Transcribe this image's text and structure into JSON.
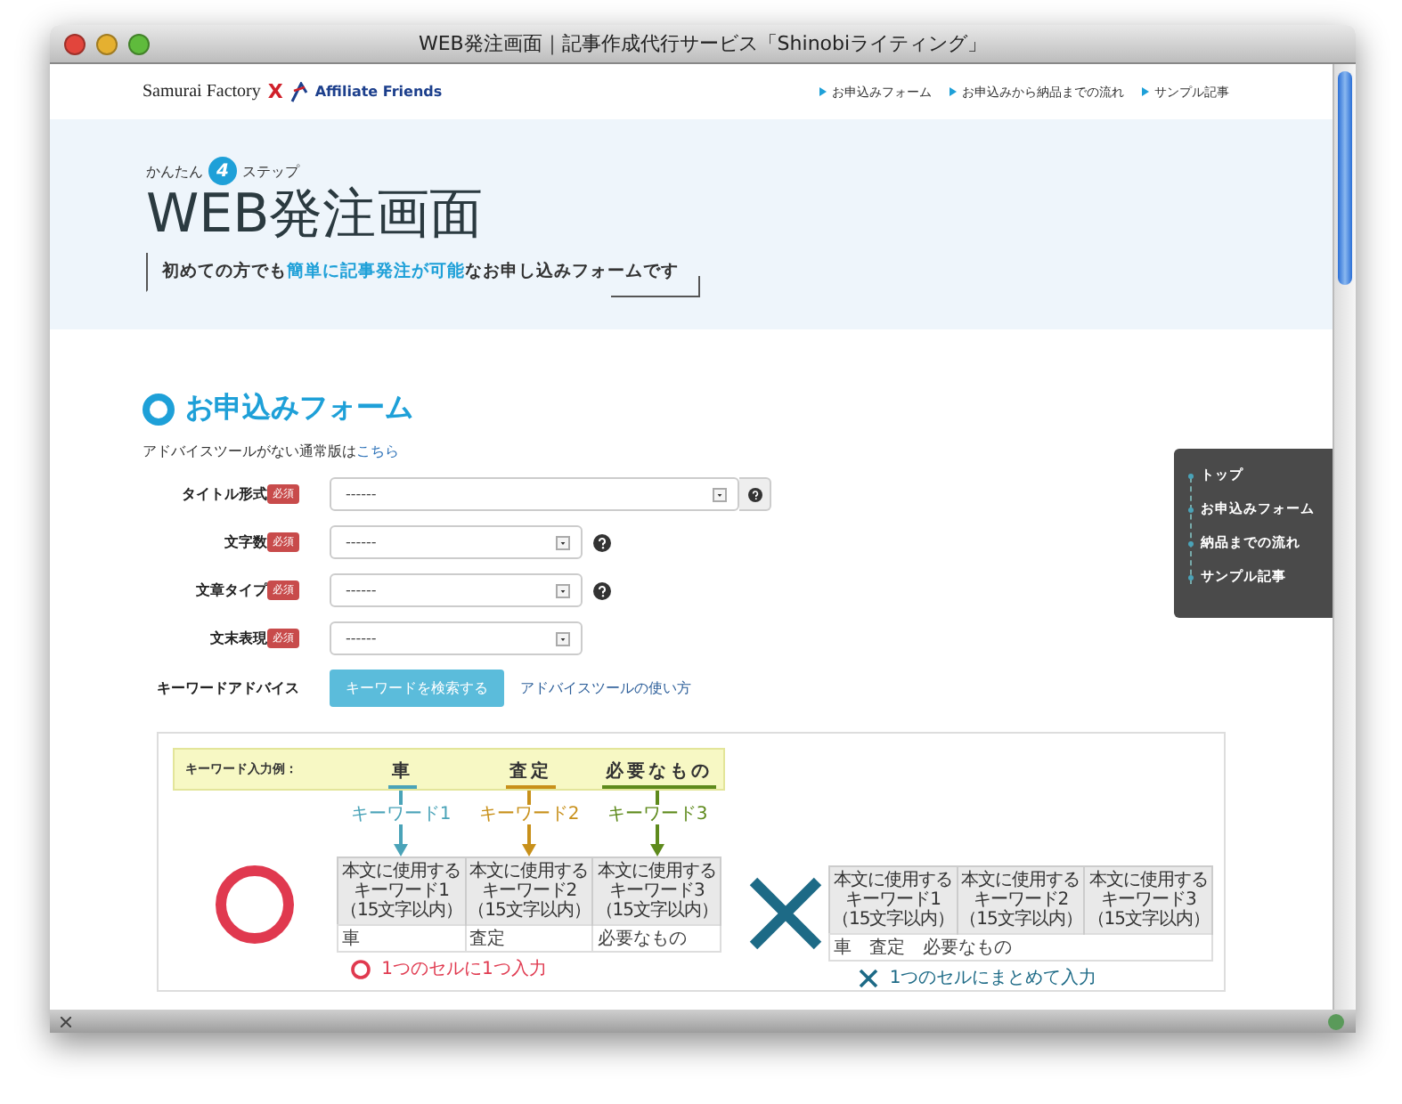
{
  "window": {
    "title": "WEB発注画面｜記事作成代行サービス「Shinobiライティング」"
  },
  "header": {
    "logo": {
      "brand1": "Samurai Factory",
      "separator": "X",
      "brand2": "Affiliate Friends"
    },
    "nav": [
      "お申込みフォーム",
      "お申込みから納品までの流れ",
      "サンプル記事"
    ]
  },
  "hero": {
    "steps_prefix": "かんたん",
    "step_number": "4",
    "steps_suffix": "ステップ",
    "title": "WEB発注画面",
    "subtitle": [
      {
        "text": "初めての方でも",
        "highlight": false
      },
      {
        "text": "簡単に記事発注が可能",
        "highlight": true
      },
      {
        "text": "なお申し込みフォームです",
        "highlight": false
      }
    ]
  },
  "section": {
    "title": "お申込みフォーム",
    "note": "アドバイスツールがない通常版は",
    "note_link": "こちら"
  },
  "form": {
    "fields": [
      {
        "label": "タイトル形式",
        "badge": "必須",
        "value": "------",
        "kind": "wide"
      },
      {
        "label": "文字数",
        "badge": "必須",
        "value": "------",
        "kind": "narrow"
      },
      {
        "label": "文章タイプ",
        "badge": "必須",
        "value": "------",
        "kind": "narrow"
      },
      {
        "label": "文末表現",
        "badge": "必須",
        "value": "------",
        "kind": "plain"
      }
    ],
    "keyword": {
      "label": "キーワードアドバイス",
      "button": "キーワードを検索する",
      "link": "アドバイスツールの使い方"
    }
  },
  "side_nav": [
    "トップ",
    "お申込みフォーム",
    "納品までの流れ",
    "サンプル記事"
  ],
  "example": {
    "label": "キーワード入力例：",
    "words": [
      {
        "text": "車",
        "keyword": "キーワード1",
        "color": "#4aa3b8"
      },
      {
        "text": "査定",
        "keyword": "キーワード2",
        "color": "#c8901a"
      },
      {
        "text": "必要なもの",
        "keyword": "キーワード3",
        "color": "#5e8a1c"
      }
    ],
    "good": {
      "headers": [
        [
          "本文に使用する",
          "キーワード1",
          "（15文字以内）"
        ],
        [
          "本文に使用する",
          "キーワード2",
          "（15文字以内）"
        ],
        [
          "本文に使用する",
          "キーワード3",
          "（15文字以内）"
        ]
      ],
      "cells": [
        "車",
        "査定",
        "必要なもの"
      ],
      "caption": "1つのセルに1つ入力"
    },
    "bad": {
      "headers": [
        [
          "本文に使用する",
          "キーワード1",
          "（15文字以内）"
        ],
        [
          "本文に使用する",
          "キーワード2",
          "（15文字以内）"
        ],
        [
          "本文に使用する",
          "キーワード3",
          "（15文字以内）"
        ]
      ],
      "cells": [
        "車　査定　必要なもの"
      ],
      "caption": "1つのセルにまとめて入力"
    }
  }
}
